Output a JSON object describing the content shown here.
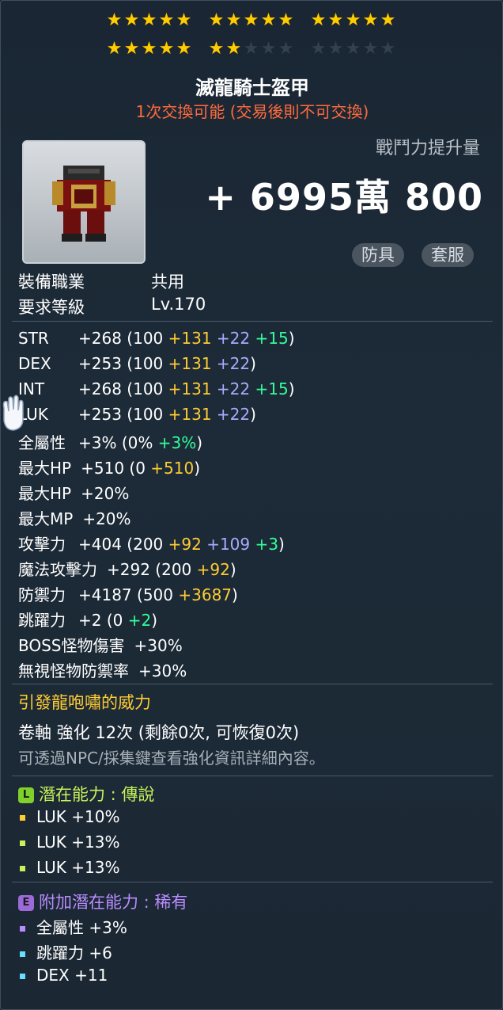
{
  "stars": {
    "row1": [
      [
        1,
        1,
        1,
        1,
        1
      ],
      [
        1,
        1,
        1,
        1,
        1
      ],
      [
        1,
        1,
        1,
        1,
        1
      ]
    ],
    "row2": [
      [
        1,
        1,
        1,
        1,
        1
      ],
      [
        1,
        1,
        0,
        0,
        0
      ],
      [
        0,
        0,
        0,
        0,
        0
      ]
    ],
    "on_color": "#ffcc00",
    "off_color": "#33414d"
  },
  "item": {
    "name": "滅龍騎士盔甲",
    "trade_note": "1次交換可能 (交易後則不可交換)",
    "icon": "armor-icon"
  },
  "combat_power": {
    "label": "戰鬥力提升量",
    "value": "+ 6995萬 800"
  },
  "tags": [
    "防具",
    "套服"
  ],
  "requirements": {
    "job_label": "裝備職業",
    "job_value": "共用",
    "level_label": "要求等級",
    "level_value": "Lv.170"
  },
  "stats": [
    {
      "name": "STR",
      "parts": [
        {
          "t": "+268 (100 ",
          "c": "w"
        },
        {
          "t": "+131 ",
          "c": "y"
        },
        {
          "t": "+22 ",
          "c": "p"
        },
        {
          "t": "+15",
          "c": "g"
        },
        {
          "t": ")",
          "c": "w"
        }
      ]
    },
    {
      "name": "DEX",
      "parts": [
        {
          "t": "+253 (100 ",
          "c": "w"
        },
        {
          "t": "+131 ",
          "c": "y"
        },
        {
          "t": "+22",
          "c": "p"
        },
        {
          "t": ")",
          "c": "w"
        }
      ]
    },
    {
      "name": "INT",
      "parts": [
        {
          "t": "+268 (100 ",
          "c": "w"
        },
        {
          "t": "+131 ",
          "c": "y"
        },
        {
          "t": "+22 ",
          "c": "p"
        },
        {
          "t": "+15",
          "c": "g"
        },
        {
          "t": ")",
          "c": "w"
        }
      ]
    },
    {
      "name": "LUK",
      "parts": [
        {
          "t": "+253 (100 ",
          "c": "w"
        },
        {
          "t": "+131 ",
          "c": "y"
        },
        {
          "t": "+22",
          "c": "p"
        },
        {
          "t": ")",
          "c": "w"
        }
      ]
    },
    {
      "name": "全屬性",
      "parts": [
        {
          "t": "+3% (0% ",
          "c": "w"
        },
        {
          "t": "+3%",
          "c": "g"
        },
        {
          "t": ")",
          "c": "w"
        }
      ]
    },
    {
      "name": "最大HP",
      "parts": [
        {
          "t": "+510 (0 ",
          "c": "w"
        },
        {
          "t": "+510",
          "c": "y"
        },
        {
          "t": ")",
          "c": "w"
        }
      ]
    },
    {
      "name": "最大HP",
      "parts": [
        {
          "t": "+20%",
          "c": "w"
        }
      ]
    },
    {
      "name": "最大MP",
      "parts": [
        {
          "t": "+20%",
          "c": "w"
        }
      ]
    },
    {
      "name": "攻擊力",
      "parts": [
        {
          "t": "+404 (200 ",
          "c": "w"
        },
        {
          "t": "+92 ",
          "c": "y"
        },
        {
          "t": "+109 ",
          "c": "p"
        },
        {
          "t": "+3",
          "c": "g"
        },
        {
          "t": ")",
          "c": "w"
        }
      ]
    },
    {
      "name": "魔法攻擊力",
      "parts": [
        {
          "t": "+292 (200 ",
          "c": "w"
        },
        {
          "t": "+92",
          "c": "y"
        },
        {
          "t": ")",
          "c": "w"
        }
      ]
    },
    {
      "name": "防禦力",
      "parts": [
        {
          "t": "+4187 (500 ",
          "c": "w"
        },
        {
          "t": "+3687",
          "c": "y"
        },
        {
          "t": ")",
          "c": "w"
        }
      ]
    },
    {
      "name": "跳躍力",
      "parts": [
        {
          "t": "+2 (0 ",
          "c": "w"
        },
        {
          "t": "+2",
          "c": "g"
        },
        {
          "t": ")",
          "c": "w"
        }
      ]
    },
    {
      "name": "BOSS怪物傷害",
      "parts": [
        {
          "t": "+30%",
          "c": "w"
        }
      ]
    },
    {
      "name": "無視怪物防禦率",
      "parts": [
        {
          "t": "+30%",
          "c": "w"
        }
      ]
    }
  ],
  "special_ability": "引發龍咆嘯的威力",
  "scroll_info": "卷軸 強化 12次 (剩餘0次, 可恢復0次)",
  "hint": "可透過NPC/採集鍵查看強化資訊詳細內容。",
  "potential": {
    "badge": "L",
    "badge_color": "#7fd02a",
    "label": "潛在能力 : 傳說",
    "label_color": "#c6f25a",
    "lines": [
      {
        "text": "LUK +10%",
        "bullet": "#ffcc33"
      },
      {
        "text": "LUK +13%",
        "bullet": "#c6f25a"
      },
      {
        "text": "LUK +13%",
        "bullet": "#c6f25a"
      }
    ]
  },
  "additional_potential": {
    "badge": "E",
    "badge_color": "#9b6ad6",
    "label": "附加潛在能力 : 稀有",
    "label_color": "#b98cff",
    "lines": [
      {
        "text": "全屬性 +3%",
        "bullet": "#b98cff"
      },
      {
        "text": "跳躍力 +6",
        "bullet": "#66e0ff"
      },
      {
        "text": "DEX +11",
        "bullet": "#66e0ff"
      }
    ]
  }
}
